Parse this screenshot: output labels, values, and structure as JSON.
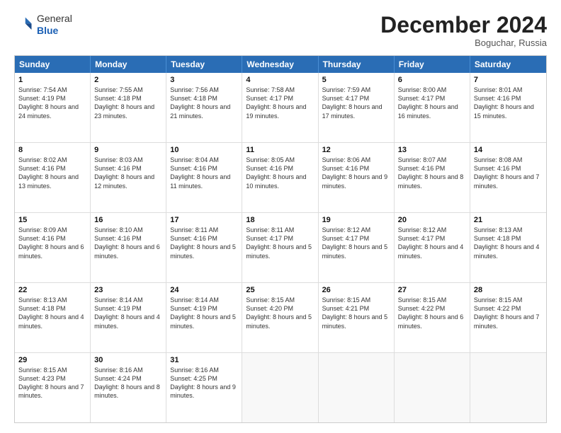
{
  "header": {
    "logo_general": "General",
    "logo_blue": "Blue",
    "month_title": "December 2024",
    "location": "Boguchar, Russia"
  },
  "days_of_week": [
    "Sunday",
    "Monday",
    "Tuesday",
    "Wednesday",
    "Thursday",
    "Friday",
    "Saturday"
  ],
  "weeks": [
    [
      {
        "day": 1,
        "sunrise": "7:54 AM",
        "sunset": "4:19 PM",
        "daylight": "8 hours and 24 minutes."
      },
      {
        "day": 2,
        "sunrise": "7:55 AM",
        "sunset": "4:18 PM",
        "daylight": "8 hours and 23 minutes."
      },
      {
        "day": 3,
        "sunrise": "7:56 AM",
        "sunset": "4:18 PM",
        "daylight": "8 hours and 21 minutes."
      },
      {
        "day": 4,
        "sunrise": "7:58 AM",
        "sunset": "4:17 PM",
        "daylight": "8 hours and 19 minutes."
      },
      {
        "day": 5,
        "sunrise": "7:59 AM",
        "sunset": "4:17 PM",
        "daylight": "8 hours and 17 minutes."
      },
      {
        "day": 6,
        "sunrise": "8:00 AM",
        "sunset": "4:17 PM",
        "daylight": "8 hours and 16 minutes."
      },
      {
        "day": 7,
        "sunrise": "8:01 AM",
        "sunset": "4:16 PM",
        "daylight": "8 hours and 15 minutes."
      }
    ],
    [
      {
        "day": 8,
        "sunrise": "8:02 AM",
        "sunset": "4:16 PM",
        "daylight": "8 hours and 13 minutes."
      },
      {
        "day": 9,
        "sunrise": "8:03 AM",
        "sunset": "4:16 PM",
        "daylight": "8 hours and 12 minutes."
      },
      {
        "day": 10,
        "sunrise": "8:04 AM",
        "sunset": "4:16 PM",
        "daylight": "8 hours and 11 minutes."
      },
      {
        "day": 11,
        "sunrise": "8:05 AM",
        "sunset": "4:16 PM",
        "daylight": "8 hours and 10 minutes."
      },
      {
        "day": 12,
        "sunrise": "8:06 AM",
        "sunset": "4:16 PM",
        "daylight": "8 hours and 9 minutes."
      },
      {
        "day": 13,
        "sunrise": "8:07 AM",
        "sunset": "4:16 PM",
        "daylight": "8 hours and 8 minutes."
      },
      {
        "day": 14,
        "sunrise": "8:08 AM",
        "sunset": "4:16 PM",
        "daylight": "8 hours and 7 minutes."
      }
    ],
    [
      {
        "day": 15,
        "sunrise": "8:09 AM",
        "sunset": "4:16 PM",
        "daylight": "8 hours and 6 minutes."
      },
      {
        "day": 16,
        "sunrise": "8:10 AM",
        "sunset": "4:16 PM",
        "daylight": "8 hours and 6 minutes."
      },
      {
        "day": 17,
        "sunrise": "8:11 AM",
        "sunset": "4:16 PM",
        "daylight": "8 hours and 5 minutes."
      },
      {
        "day": 18,
        "sunrise": "8:11 AM",
        "sunset": "4:17 PM",
        "daylight": "8 hours and 5 minutes."
      },
      {
        "day": 19,
        "sunrise": "8:12 AM",
        "sunset": "4:17 PM",
        "daylight": "8 hours and 5 minutes."
      },
      {
        "day": 20,
        "sunrise": "8:12 AM",
        "sunset": "4:17 PM",
        "daylight": "8 hours and 4 minutes."
      },
      {
        "day": 21,
        "sunrise": "8:13 AM",
        "sunset": "4:18 PM",
        "daylight": "8 hours and 4 minutes."
      }
    ],
    [
      {
        "day": 22,
        "sunrise": "8:13 AM",
        "sunset": "4:18 PM",
        "daylight": "8 hours and 4 minutes."
      },
      {
        "day": 23,
        "sunrise": "8:14 AM",
        "sunset": "4:19 PM",
        "daylight": "8 hours and 4 minutes."
      },
      {
        "day": 24,
        "sunrise": "8:14 AM",
        "sunset": "4:19 PM",
        "daylight": "8 hours and 5 minutes."
      },
      {
        "day": 25,
        "sunrise": "8:15 AM",
        "sunset": "4:20 PM",
        "daylight": "8 hours and 5 minutes."
      },
      {
        "day": 26,
        "sunrise": "8:15 AM",
        "sunset": "4:21 PM",
        "daylight": "8 hours and 5 minutes."
      },
      {
        "day": 27,
        "sunrise": "8:15 AM",
        "sunset": "4:22 PM",
        "daylight": "8 hours and 6 minutes."
      },
      {
        "day": 28,
        "sunrise": "8:15 AM",
        "sunset": "4:22 PM",
        "daylight": "8 hours and 7 minutes."
      }
    ],
    [
      {
        "day": 29,
        "sunrise": "8:15 AM",
        "sunset": "4:23 PM",
        "daylight": "8 hours and 7 minutes."
      },
      {
        "day": 30,
        "sunrise": "8:16 AM",
        "sunset": "4:24 PM",
        "daylight": "8 hours and 8 minutes."
      },
      {
        "day": 31,
        "sunrise": "8:16 AM",
        "sunset": "4:25 PM",
        "daylight": "8 hours and 9 minutes."
      },
      null,
      null,
      null,
      null
    ]
  ]
}
